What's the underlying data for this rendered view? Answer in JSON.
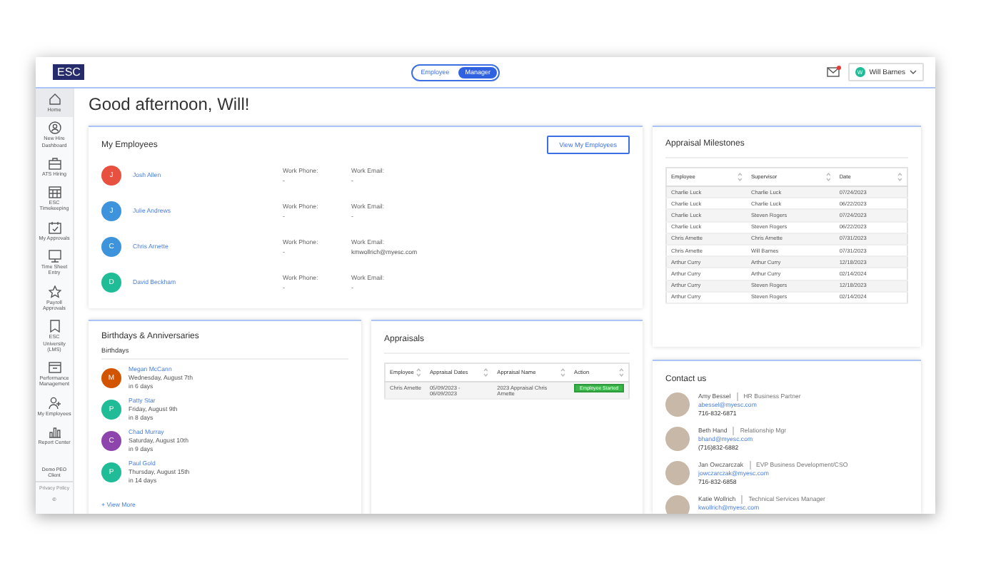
{
  "topbar": {
    "logo": "ESC",
    "view_toggle": [
      {
        "label": "Employee",
        "selected": false
      },
      {
        "label": "Manager",
        "selected": true
      }
    ],
    "mail_unread": true,
    "user": {
      "initial": "W",
      "name": "Will Barnes"
    }
  },
  "sidebar": {
    "items": [
      {
        "label": "Home",
        "selected": true
      },
      {
        "label": "New Hire Dashboard",
        "selected": false
      },
      {
        "label": "ATS Hiring",
        "selected": false
      },
      {
        "label": "ESC Timekeeping",
        "selected": false
      },
      {
        "label": "My Approvals",
        "selected": false
      },
      {
        "label": "Time Sheet Entry",
        "selected": false
      },
      {
        "label": "Payroll Approvals",
        "selected": false
      },
      {
        "label": "ESC University (LMS)",
        "selected": false
      },
      {
        "label": "Performance Management",
        "selected": false
      },
      {
        "label": "My Employees",
        "selected": false
      },
      {
        "label": "Report Center",
        "selected": false
      }
    ],
    "footer": {
      "client": "Demo PEO Client",
      "privacy": "Privacy Policy",
      "copyright": "©"
    }
  },
  "greeting": "Good afternoon, Will!",
  "my_employees": {
    "title": "My Employees",
    "button": "View My Employees",
    "employees": [
      {
        "initial": "J",
        "name": "Josh Allen",
        "color": "#e8503f",
        "phone_label": "Work Phone:",
        "phone": "-",
        "email_label": "Work Email:",
        "email": "-"
      },
      {
        "initial": "J",
        "name": "Julie Andrews",
        "color": "#3d94dc",
        "phone_label": "Work Phone:",
        "phone": "-",
        "email_label": "Work Email:",
        "email": "-"
      },
      {
        "initial": "C",
        "name": "Chris Arnette",
        "color": "#3d94dc",
        "phone_label": "Work Phone:",
        "phone": "-",
        "email_label": "Work Email:",
        "email": "kmwollrich@myesc.com"
      },
      {
        "initial": "D",
        "name": "David Beckham",
        "color": "#1fbc97",
        "phone_label": "Work Phone:",
        "phone": "-",
        "email_label": "Work Email:",
        "email": "-"
      }
    ]
  },
  "appraisal_milestones": {
    "title": "Appraisal Milestones",
    "columns": [
      "Employee",
      "Supervisor",
      "Date"
    ],
    "rows": [
      [
        "Charlie Luck",
        "Charlie Luck",
        "07/24/2023"
      ],
      [
        "Charlie Luck",
        "Charlie Luck",
        "06/22/2023"
      ],
      [
        "Charlie Luck",
        "Steven Rogers",
        "07/24/2023"
      ],
      [
        "Charlie Luck",
        "Steven Rogers",
        "06/22/2023"
      ],
      [
        "Chris Arnette",
        "Chris Arnette",
        "07/31/2023"
      ],
      [
        "Chris Arnette",
        "Will Barnes",
        "07/31/2023"
      ],
      [
        "Arthur Curry",
        "Arthur Curry",
        "12/18/2023"
      ],
      [
        "Arthur Curry",
        "Arthur Curry",
        "02/14/2024"
      ],
      [
        "Arthur Curry",
        "Steven Rogers",
        "12/18/2023"
      ],
      [
        "Arthur Curry",
        "Steven Rogers",
        "02/14/2024"
      ]
    ]
  },
  "birthdays": {
    "title": "Birthdays & Anniversaries",
    "subtitle": "Birthdays",
    "people": [
      {
        "initial": "M",
        "name": "Megan McCann",
        "color": "#d35400",
        "date": "Wednesday, August 7th",
        "when": "in 6 days"
      },
      {
        "initial": "P",
        "name": "Patty Star",
        "color": "#1fbc97",
        "date": "Friday, August 9th",
        "when": "in 8 days"
      },
      {
        "initial": "C",
        "name": "Chad Murray",
        "color": "#8e44ad",
        "date": "Saturday, August 10th",
        "when": "in 9 days"
      },
      {
        "initial": "P",
        "name": "Paul Gold",
        "color": "#1fbc97",
        "date": "Thursday, August 15th",
        "when": "in 14 days"
      }
    ],
    "more": "+ View More"
  },
  "appraisals": {
    "title": "Appraisals",
    "columns": [
      "Employee",
      "Appraisal Dates",
      "Appraisal Name",
      "Action"
    ],
    "rows": [
      {
        "employee": "Chris Arnette",
        "dates": "05/09/2023 - 06/09/2023",
        "name": "2023 Appraisal Chris Arnette",
        "action": "Employee Started"
      }
    ]
  },
  "contact": {
    "title": "Contact us",
    "people": [
      {
        "name": "Amy Bessel",
        "role": "HR Business Partner",
        "email": "abessel@myesc.com",
        "phone": "716-832-6871"
      },
      {
        "name": "Beth Hand",
        "role": "Relationship Mgr",
        "email": "bhand@myesc.com",
        "phone": "(716)832-6882"
      },
      {
        "name": "Jan Owczarczak",
        "role": "EVP Business Development/CSO",
        "email": "jowczarczak@myesc.com",
        "phone": "716-832-6858"
      },
      {
        "name": "Katie Wollrich",
        "role": "Technical Services Manager",
        "email": "kwollrich@myesc.com"
      }
    ]
  }
}
